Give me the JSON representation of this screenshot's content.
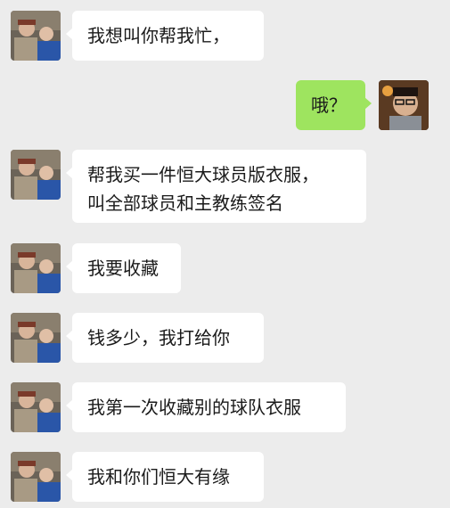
{
  "messages": [
    {
      "side": "in",
      "lines": [
        "我想叫你帮我忙，"
      ]
    },
    {
      "side": "out",
      "lines": [
        "哦？"
      ]
    },
    {
      "side": "in",
      "lines": [
        "帮我买一件恒大球员版衣服，",
        "叫全部球员和主教练签名"
      ]
    },
    {
      "side": "in",
      "lines": [
        "我要收藏"
      ]
    },
    {
      "side": "in",
      "lines": [
        "钱多少，我打给你"
      ]
    },
    {
      "side": "in",
      "lines": [
        "我第一次收藏别的球队衣服"
      ]
    },
    {
      "side": "in",
      "lines": [
        "我和你们恒大有缘"
      ]
    }
  ],
  "colors": {
    "background": "#ececec",
    "incoming_bubble": "#ffffff",
    "outgoing_bubble": "#9ee45f"
  }
}
